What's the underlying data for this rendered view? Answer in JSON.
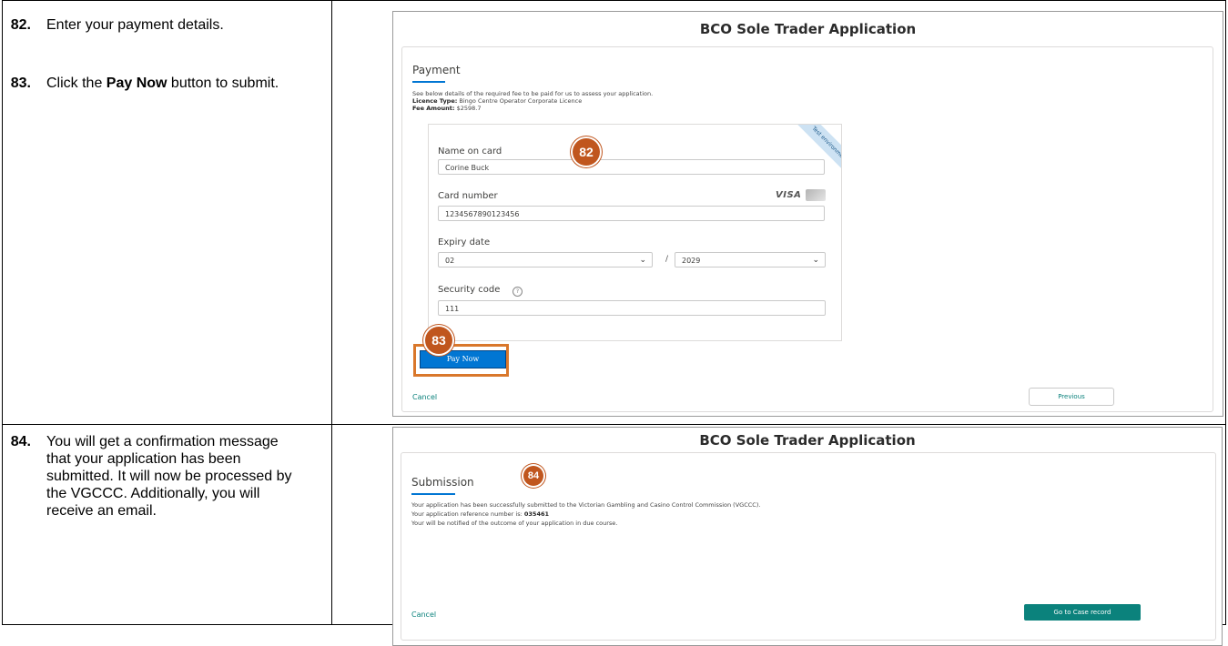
{
  "steps": [
    {
      "number": "82.",
      "text": "Enter your payment details."
    },
    {
      "number": "83.",
      "text_before": "Click the ",
      "text_bold": "Pay Now",
      "text_after": " button to submit."
    },
    {
      "number": "84.",
      "text": "You will get a confirmation message that your application has been submitted. It will now be processed by the VGCCC. Additionally, you will receive an email."
    }
  ],
  "payment_screen": {
    "app_title": "BCO Sole Trader Application",
    "section_title": "Payment",
    "intro": "See below details of the required fee to be paid for us to assess your application.",
    "licence_type_label": "Licence Type:",
    "licence_type_value": "Bingo Centre Operator Corporate Licence",
    "fee_amount_label": "Fee Amount:",
    "fee_amount_value": "$2598.7",
    "ribbon_text": "Test environment",
    "name_label": "Name on card",
    "name_value": "Corine Buck",
    "card_label": "Card number",
    "card_brand": "VISA",
    "card_value": "1234567890123456",
    "expiry_label": "Expiry date",
    "expiry_month": "02",
    "expiry_separator": "/",
    "expiry_year": "2029",
    "security_label": "Security code",
    "security_help": "?",
    "security_value": "111",
    "pay_button": "Pay Now",
    "cancel_link": "Cancel",
    "previous_button": "Previous",
    "badge_82": "82",
    "badge_83": "83"
  },
  "submission_screen": {
    "app_title": "BCO Sole Trader Application",
    "section_title": "Submission",
    "badge_84": "84",
    "line1": "Your application has been successfully submitted to the Victorian Gambling and Casino Control Commission (VGCCC).",
    "line2_label": "Your application reference number is:",
    "line2_value": "035461",
    "line3": "Your will be notified of the outcome of your application in due course.",
    "cancel_link": "Cancel",
    "go_button": "Go to Case record"
  },
  "icons": {
    "chevron": "chevron-down-icon",
    "help": "help-circle-icon",
    "card": "credit-card-icon"
  }
}
